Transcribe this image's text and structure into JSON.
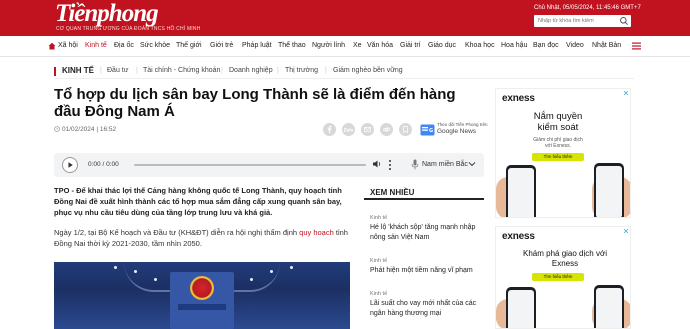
{
  "header": {
    "logo": "Tiềnphong",
    "logo_sub": "CƠ QUAN TRUNG ƯƠNG CỦA ĐOÀN TNCS HỒ CHÍ MINH",
    "datetime": "Chủ Nhật, 05/05/2024, 11:45:46 GMT+7",
    "search_placeholder": "Nhập từ khóa tìm kiếm"
  },
  "nav": {
    "items": [
      "Xã hội",
      "Kinh tế",
      "Địa ốc",
      "Sức khỏe",
      "Thế giới",
      "Giới trẻ",
      "Pháp luật",
      "Thể thao",
      "Người lính",
      "Xe",
      "Văn hóa",
      "Giải trí",
      "Giáo dục",
      "Khoa học",
      "Hoa hậu",
      "Bạn đọc",
      "Video",
      "Nhật Bản"
    ],
    "active": "Kinh tế"
  },
  "breadcrumb": {
    "category": "KINH TẾ",
    "subs": [
      "Đầu tư",
      "Tài chính - Chứng khoán",
      "Doanh nghiệp",
      "Thị trường",
      "Giảm nghèo bền vững"
    ]
  },
  "article": {
    "title": "Tổ hợp du lịch sân bay Long Thành sẽ là điểm đến hàng đầu Đông Nam Á",
    "published": "01/02/2024 | 16:52",
    "google_news_pre": "Theo dõi Tiền Phong trên",
    "google_news": "Google News",
    "lead": "TPO - Để khai thác lợi thế Cảng hàng không quốc tế Long Thành, quy hoạch tỉnh Đồng Nai đề xuất hình thành các tổ hợp mua sắm đẳng cấp xung quanh sân bay, phục vụ nhu cầu tiêu dùng của tầng lớp trung lưu và khá giả.",
    "para_pre": "Ngày 1/2, tại Bộ Kế hoạch và Đầu tư (KH&ĐT) diễn ra hội nghị thẩm định ",
    "para_link": "quy hoạch",
    "para_post": " tỉnh Đồng Nai thời kỳ 2021-2030, tầm nhìn 2050."
  },
  "player": {
    "time": "0:00 / 0:00",
    "voice": "Nam miền Bắc"
  },
  "xem_nhieu": {
    "heading": "XEM NHIỀU",
    "items": [
      {
        "category": "Kinh tế",
        "title": "Hé lộ 'khách sộp' tăng mạnh nhập nông sản Việt Nam"
      },
      {
        "category": "Kinh tế",
        "title": "Phát hiện một tiềm năng vĩ phạm"
      },
      {
        "category": "Kinh tế",
        "title": "Lãi suất cho vay mới nhất của các ngân hàng thương mại"
      }
    ]
  },
  "ads": [
    {
      "brand": "exness",
      "headline": "Nắm quyền kiểm soát",
      "sub": "Giảm chi phí giao dịch với Exness.",
      "cta": "Tìm hiểu thêm"
    },
    {
      "brand": "exness",
      "headline": "Khám phá giao dịch với Exness",
      "sub": "",
      "cta": "Tìm hiểu thêm"
    }
  ],
  "colors": {
    "brand_red": "#c1121f",
    "ad_lime": "#d7e400"
  }
}
